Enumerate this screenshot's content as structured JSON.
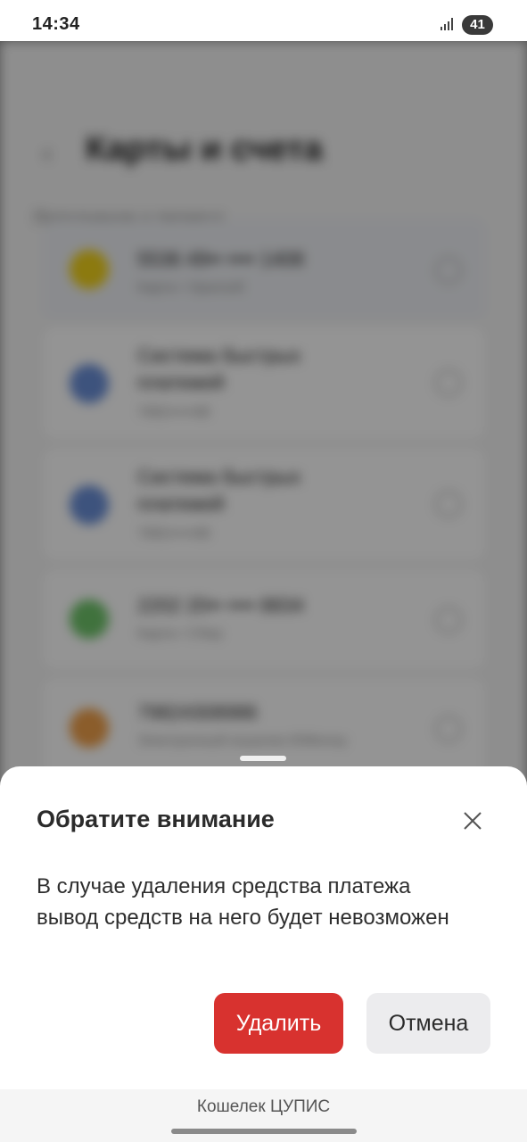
{
  "status_bar": {
    "time": "14:34",
    "battery": "41"
  },
  "background": {
    "title": "Карты и счета",
    "subtitle": "Пополнение и перевод",
    "items": [
      {
        "name": "5536 49•• •••• 1408",
        "desc": "Карта • Уралсиб",
        "icon_color": "#f2d21a"
      },
      {
        "name": "Система быстрых платежей",
        "desc": "7982•••••98",
        "icon_color": "#6a8fd8"
      },
      {
        "name": "Система быстрых платежей",
        "desc": "7982•••••98",
        "icon_color": "#6a8fd8"
      },
      {
        "name": "2202 20•• •••• 8834",
        "desc": "Карта • Сбер",
        "icon_color": "#6fc56a"
      },
      {
        "name": "79824308986",
        "desc": "Электронный кошелек ЮMoney",
        "icon_color": "#f0a04a"
      }
    ]
  },
  "sheet": {
    "title": "Обратите внимание",
    "message": "В случае удаления средства платежа вывод средств на него будет невозможен",
    "delete_label": "Удалить",
    "cancel_label": "Отмена",
    "delete_color": "#d8322f"
  },
  "footer": {
    "label": "Кошелек ЦУПИС"
  }
}
